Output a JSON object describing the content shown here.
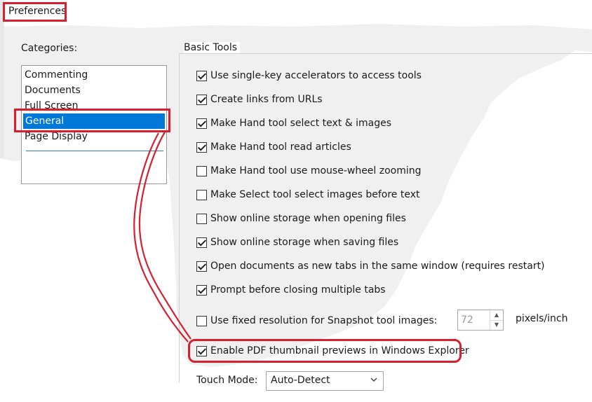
{
  "window": {
    "title": "Preferences"
  },
  "categories": {
    "label": "Categories:",
    "items": [
      {
        "label": "Commenting",
        "selected": false
      },
      {
        "label": "Documents",
        "selected": false
      },
      {
        "label": "Full Screen",
        "selected": false
      },
      {
        "label": "General",
        "selected": true
      },
      {
        "label": "Page Display",
        "selected": false
      }
    ]
  },
  "basic_tools": {
    "label": "Basic Tools",
    "options": [
      {
        "label": "Use single-key accelerators to access tools",
        "checked": true
      },
      {
        "label": "Create links from URLs",
        "checked": true
      },
      {
        "label": "Make Hand tool select text & images",
        "checked": true
      },
      {
        "label": "Make Hand tool read articles",
        "checked": true
      },
      {
        "label": "Make Hand tool use mouse-wheel zooming",
        "checked": false
      },
      {
        "label": "Make Select tool select images before text",
        "checked": false
      },
      {
        "label": "Show online storage when opening files",
        "checked": false
      },
      {
        "label": "Show online storage when saving files",
        "checked": true
      },
      {
        "label": "Open documents as new tabs in the same window (requires restart)",
        "checked": true
      },
      {
        "label": "Prompt before closing multiple tabs",
        "checked": true
      }
    ],
    "snapshot": {
      "label": "Use fixed resolution for Snapshot tool images:",
      "checked": false,
      "value": "72",
      "units": "pixels/inch"
    },
    "thumbnail": {
      "label": "Enable PDF thumbnail previews in Windows Explorer",
      "checked": true
    },
    "touch_mode": {
      "label": "Touch Mode:",
      "value": "Auto-Detect"
    }
  },
  "colors": {
    "selection": "#0078d7",
    "highlight": "#d7202f"
  }
}
